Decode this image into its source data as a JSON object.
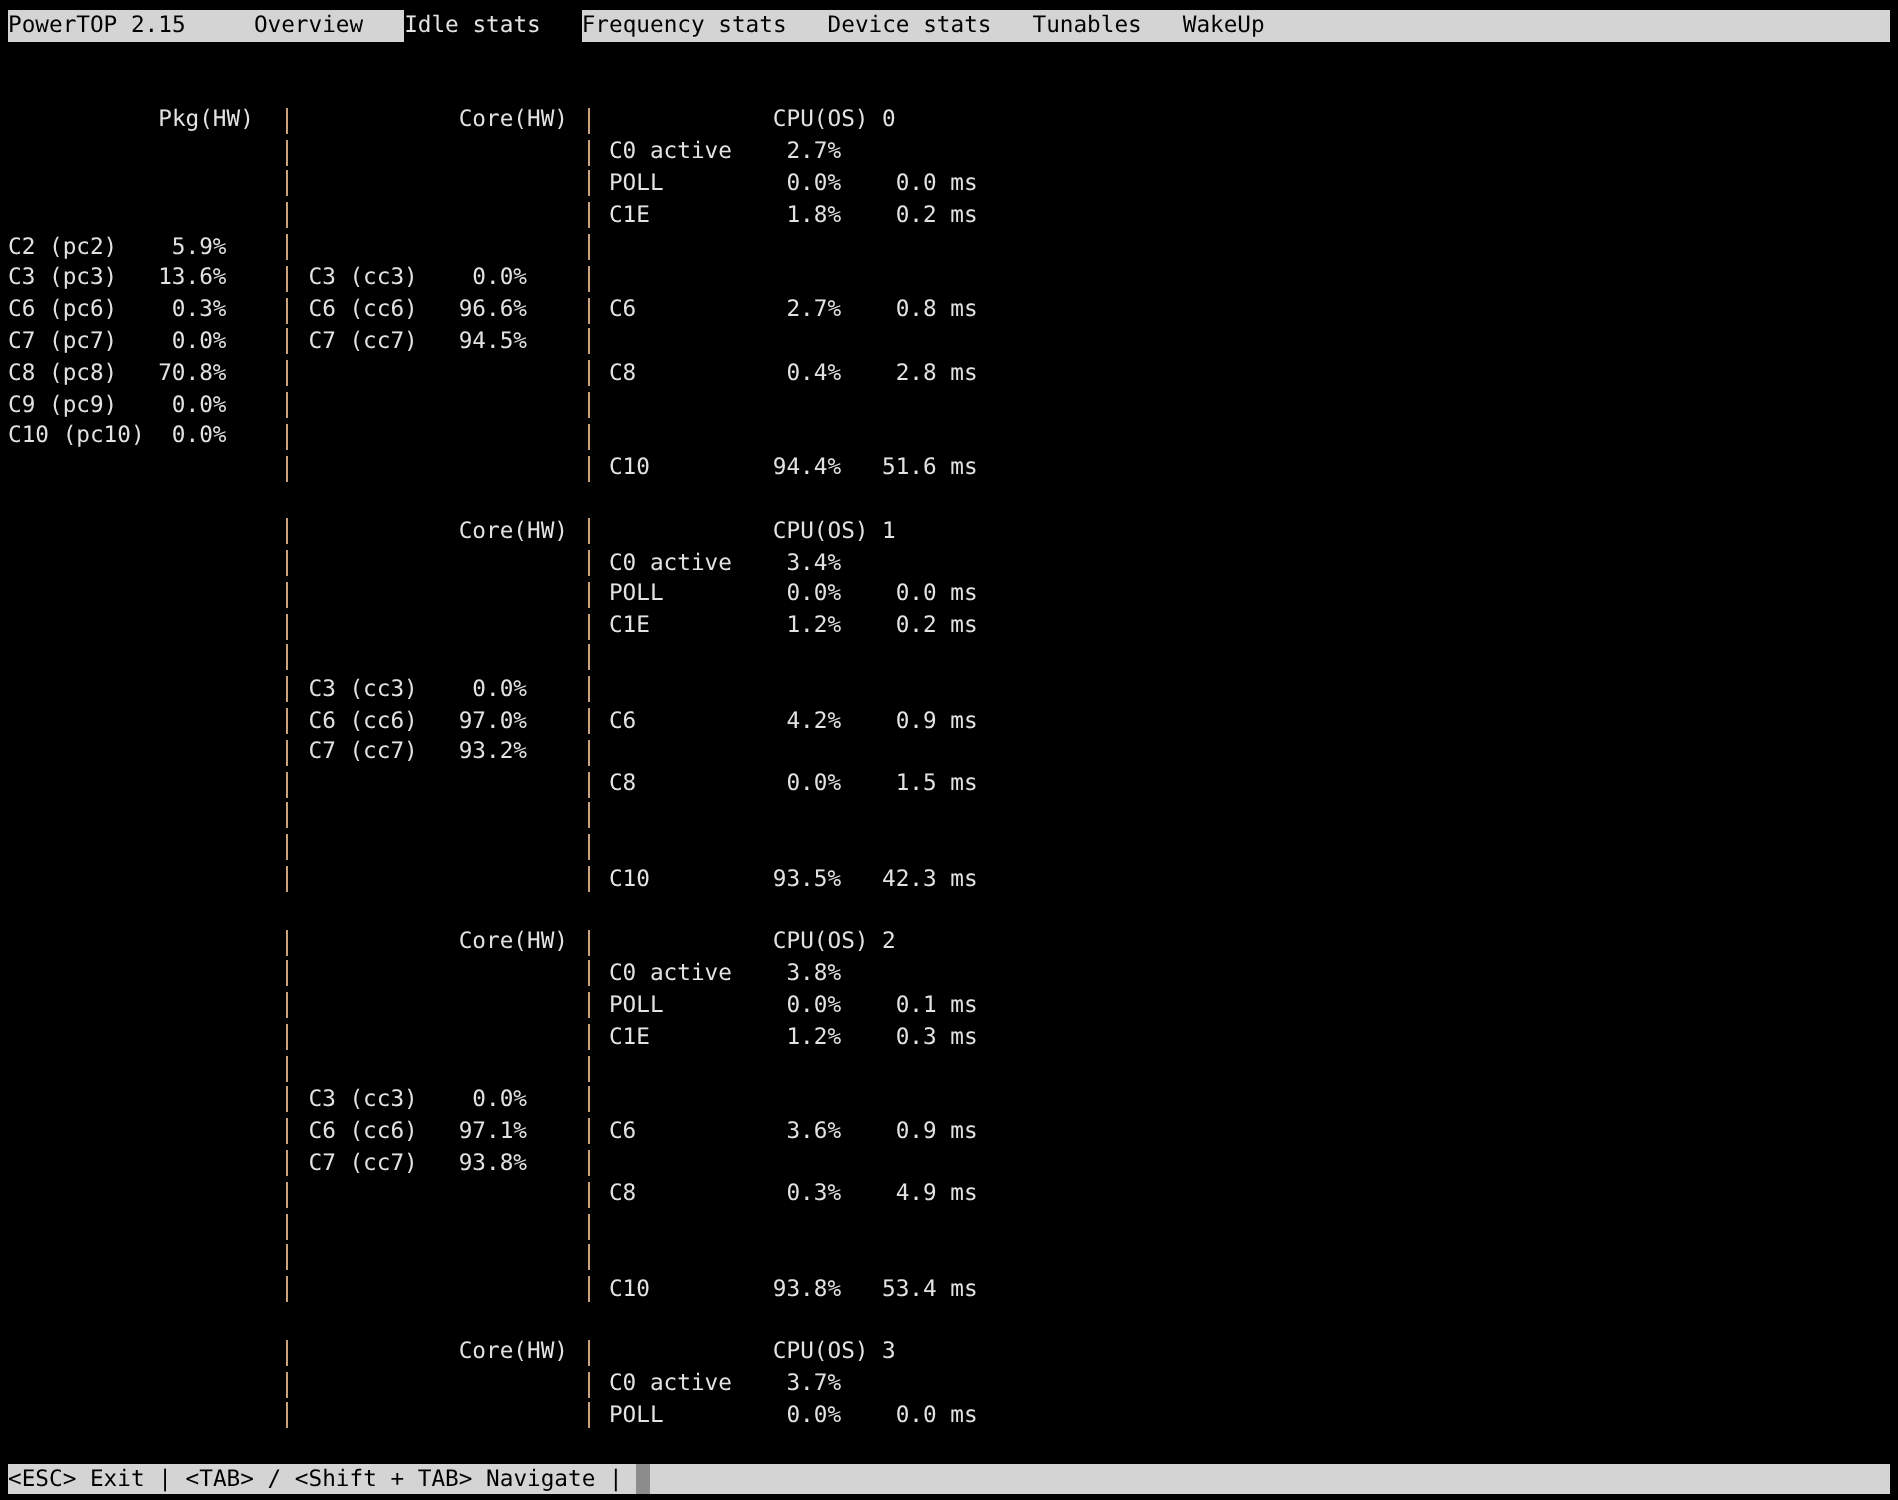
{
  "top_bar": {
    "title": "PowerTOP 2.15",
    "tabs": [
      {
        "label": "Overview",
        "selected": false
      },
      {
        "label": "Idle stats",
        "selected": true
      },
      {
        "label": "Frequency stats",
        "selected": false
      },
      {
        "label": "Device stats",
        "selected": false
      },
      {
        "label": "Tunables",
        "selected": false
      },
      {
        "label": "WakeUp",
        "selected": false
      }
    ]
  },
  "cpu_blocks": [
    {
      "pkg_header": "Pkg(HW)",
      "core_header": "Core(HW)",
      "cpu_header": "CPU(OS) 0",
      "rows": [
        {
          "cpu": {
            "state": "C0 active",
            "usage": "2.7%"
          }
        },
        {
          "cpu": {
            "state": "POLL",
            "usage": "0.0%",
            "time": "0.0 ms"
          }
        },
        {
          "cpu": {
            "state": "C1E",
            "usage": "1.8%",
            "time": "0.2 ms"
          }
        },
        {
          "pkg": {
            "state": "C2 (pc2)",
            "usage": "5.9%"
          }
        },
        {
          "pkg": {
            "state": "C3 (pc3)",
            "usage": "13.6%"
          },
          "core": {
            "state": "C3 (cc3)",
            "usage": "0.0%"
          }
        },
        {
          "pkg": {
            "state": "C6 (pc6)",
            "usage": "0.3%"
          },
          "core": {
            "state": "C6 (cc6)",
            "usage": "96.6%"
          },
          "cpu": {
            "state": "C6",
            "usage": "2.7%",
            "time": "0.8 ms"
          }
        },
        {
          "pkg": {
            "state": "C7 (pc7)",
            "usage": "0.0%"
          },
          "core": {
            "state": "C7 (cc7)",
            "usage": "94.5%"
          }
        },
        {
          "pkg": {
            "state": "C8 (pc8)",
            "usage": "70.8%"
          },
          "cpu": {
            "state": "C8",
            "usage": "0.4%",
            "time": "2.8 ms"
          }
        },
        {
          "pkg": {
            "state": "C9 (pc9)",
            "usage": "0.0%"
          }
        },
        {
          "pkg": {
            "state": "C10 (pc10)",
            "usage": "0.0%"
          }
        },
        {
          "cpu": {
            "state": "C10",
            "usage": "94.4%",
            "time": "51.6 ms"
          }
        }
      ]
    },
    {
      "core_header": "Core(HW)",
      "cpu_header": "CPU(OS) 1",
      "rows": [
        {
          "cpu": {
            "state": "C0 active",
            "usage": "3.4%"
          }
        },
        {
          "cpu": {
            "state": "POLL",
            "usage": "0.0%",
            "time": "0.0 ms"
          }
        },
        {
          "cpu": {
            "state": "C1E",
            "usage": "1.2%",
            "time": "0.2 ms"
          }
        },
        {},
        {
          "core": {
            "state": "C3 (cc3)",
            "usage": "0.0%"
          }
        },
        {
          "core": {
            "state": "C6 (cc6)",
            "usage": "97.0%"
          },
          "cpu": {
            "state": "C6",
            "usage": "4.2%",
            "time": "0.9 ms"
          }
        },
        {
          "core": {
            "state": "C7 (cc7)",
            "usage": "93.2%"
          }
        },
        {
          "cpu": {
            "state": "C8",
            "usage": "0.0%",
            "time": "1.5 ms"
          }
        },
        {},
        {},
        {
          "cpu": {
            "state": "C10",
            "usage": "93.5%",
            "time": "42.3 ms"
          }
        }
      ]
    },
    {
      "core_header": "Core(HW)",
      "cpu_header": "CPU(OS) 2",
      "rows": [
        {
          "cpu": {
            "state": "C0 active",
            "usage": "3.8%"
          }
        },
        {
          "cpu": {
            "state": "POLL",
            "usage": "0.0%",
            "time": "0.1 ms"
          }
        },
        {
          "cpu": {
            "state": "C1E",
            "usage": "1.2%",
            "time": "0.3 ms"
          }
        },
        {},
        {
          "core": {
            "state": "C3 (cc3)",
            "usage": "0.0%"
          }
        },
        {
          "core": {
            "state": "C6 (cc6)",
            "usage": "97.1%"
          },
          "cpu": {
            "state": "C6",
            "usage": "3.6%",
            "time": "0.9 ms"
          }
        },
        {
          "core": {
            "state": "C7 (cc7)",
            "usage": "93.8%"
          }
        },
        {
          "cpu": {
            "state": "C8",
            "usage": "0.3%",
            "time": "4.9 ms"
          }
        },
        {},
        {},
        {
          "cpu": {
            "state": "C10",
            "usage": "93.8%",
            "time": "53.4 ms"
          }
        }
      ]
    },
    {
      "core_header": "Core(HW)",
      "cpu_header": "CPU(OS) 3",
      "rows": [
        {
          "cpu": {
            "state": "C0 active",
            "usage": "3.7%"
          }
        },
        {
          "cpu": {
            "state": "POLL",
            "usage": "0.0%",
            "time": "0.0 ms"
          }
        }
      ]
    }
  ],
  "status_bar": {
    "text": "<ESC> Exit | <TAB> / <Shift + TAB> Navigate |"
  }
}
